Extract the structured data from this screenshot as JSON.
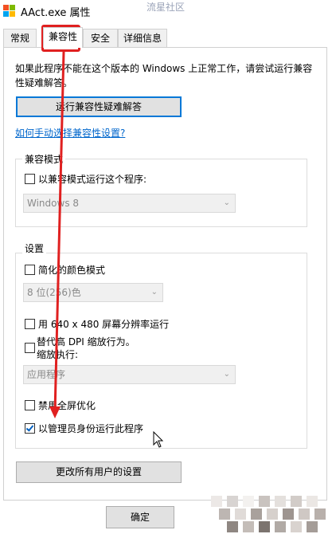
{
  "window": {
    "title": "AAct.exe 属性",
    "watermark": "流星社区"
  },
  "tabs": [
    {
      "label": "常规"
    },
    {
      "label": "兼容性"
    },
    {
      "label": "安全"
    },
    {
      "label": "详细信息"
    }
  ],
  "intro": "如果此程序不能在这个版本的 Windows 上正常工作，请尝试运行兼容性疑难解答。",
  "troubleshooter_button": "运行兼容性疑难解答",
  "manual_link": "如何手动选择兼容性设置?",
  "compat_mode": {
    "group_label": "兼容模式",
    "checkbox_label": "以兼容模式运行这个程序:",
    "checked": false,
    "select_value": "Windows 8"
  },
  "settings": {
    "group_label": "设置",
    "reduced_color": {
      "label": "简化的颜色模式",
      "checked": false
    },
    "color_select_value": "8 位(256)色",
    "res_640": {
      "label": "用 640 x 480 屏幕分辨率运行",
      "checked": false
    },
    "dpi_override": {
      "label_line1": "替代高 DPI 缩放行为。",
      "label_line2": "缩放执行:",
      "checked": false
    },
    "dpi_select_value": "应用程序",
    "disable_fullscreen": {
      "label": "禁用全屏优化",
      "checked": false
    },
    "run_as_admin": {
      "label": "以管理员身份运行此程序",
      "checked": true
    }
  },
  "all_users_button": "更改所有用户的设置",
  "ok_button": "确定",
  "colors": {
    "accent": "#0078d7",
    "annotation": "#e02020",
    "link": "#0066cc"
  }
}
